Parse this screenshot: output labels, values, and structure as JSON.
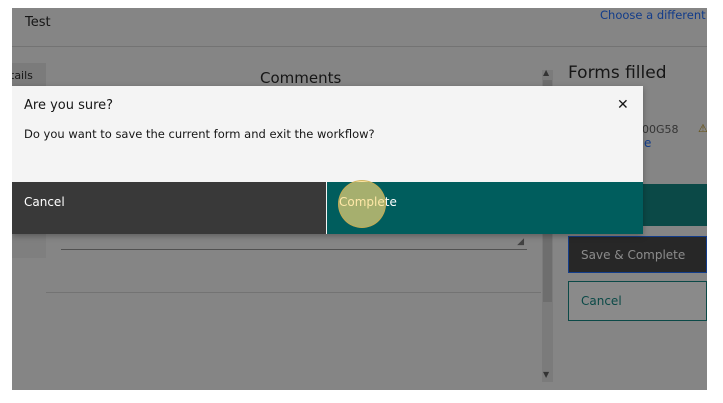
{
  "header": {
    "title": "Test",
    "choose_link": "Choose a different g"
  },
  "sidebar": {
    "tab_label": "tails"
  },
  "main": {
    "comments_title": "Comments"
  },
  "side_panel": {
    "title": "Forms filled",
    "form_code": "00G58",
    "form_link_text": "e",
    "save_complete_label": "Save & Complete",
    "cancel_label": "Cancel"
  },
  "dialog": {
    "title": "Are you sure?",
    "message": "Do you want to save the current form and exit the workflow?",
    "cancel_label": "Cancel",
    "complete_label": "Complete",
    "close_glyph": "✕"
  },
  "icons": {
    "warning": "warning-icon",
    "close": "close-icon",
    "resize": "resize-handle-icon"
  },
  "colors": {
    "primary_teal": "#005d5d",
    "accent_teal": "#007d79",
    "link_blue": "#0f62fe",
    "dark_button": "#393939"
  }
}
